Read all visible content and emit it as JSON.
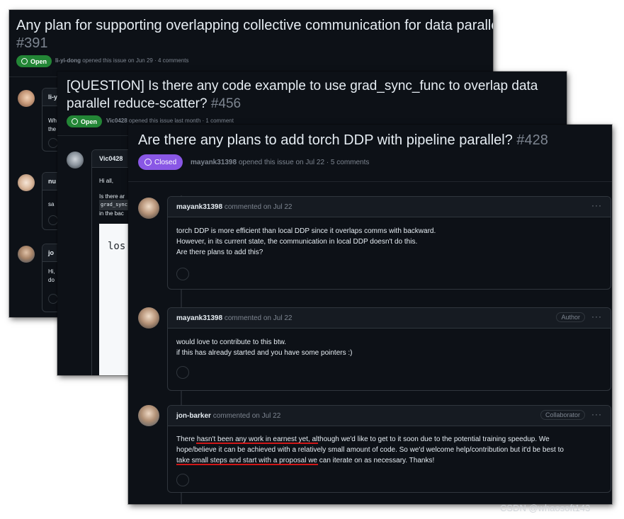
{
  "issue1": {
    "title": "Any plan for supporting overlapping collective communication for data parallel?",
    "number": "#391",
    "state": "Open",
    "user": "li-yi-dong",
    "meta": " opened this issue on Jun 29 · 4 comments",
    "comments": [
      {
        "author": "li-y",
        "text": [
          "Wh",
          "the"
        ]
      },
      {
        "author": "nu",
        "text": [
          "sa"
        ]
      },
      {
        "author": "jo",
        "text": [
          "Hi,",
          "do"
        ]
      }
    ]
  },
  "issue2": {
    "title_line1": "[QUESTION] Is there any code example to use grad_sync_func to overlap data",
    "title_line2": "parallel reduce-scatter?",
    "number": "#456",
    "state": "Open",
    "user": "Vic0428",
    "meta": " opened this issue last month · 1 comment",
    "comment_author": "Vic0428",
    "lines": [
      "Hi all,",
      "Is there ar",
      "grad_sync",
      "in the bac"
    ],
    "code": "los"
  },
  "issue3": {
    "title": "Are there any plans to add torch DDP with pipeline parallel?",
    "number": "#428",
    "state": "Closed",
    "user": "mayank31398",
    "meta": " opened this issue on Jul 22 · 5 comments",
    "comments": [
      {
        "author": "mayank31398",
        "meta": "commented on Jul 22",
        "role": "",
        "lines": [
          "torch DDP is more efficient than local DDP since it overlaps comms with backward.",
          "However, in its current state, the communication in local DDP doesn't do this.",
          "Are there plans to add this?"
        ]
      },
      {
        "author": "mayank31398",
        "meta": "commented on Jul 22",
        "role": "Author",
        "lines": [
          "would love to contribute to this btw.",
          "if this has already started and you have some pointers :)"
        ]
      },
      {
        "author": "jon-barker",
        "meta": "commented on Jul 22",
        "role": "Collaborator",
        "lines": [
          "There hasn't been any work in earnest yet, although we'd like to get to it soon due to the potential training speedup. We",
          "hope/believe it can be achieved with a relatively small amount of code. So we'd welcome help/contribution but it'd be best to",
          "take small steps and start with a proposal we can iterate on as necessary. Thanks!"
        ]
      }
    ]
  },
  "watermark": "CSDN @whaosoft143",
  "colors": {
    "open": "#238636",
    "closed": "#8957e5",
    "bg": "#0d1117",
    "underline": "#d01818"
  }
}
